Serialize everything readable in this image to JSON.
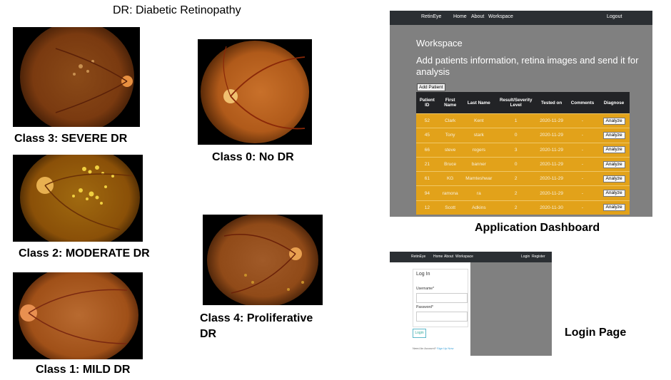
{
  "figure_title": "DR: Diabetic Retinopathy",
  "captions": {
    "class3": "Class 3: SEVERE DR",
    "class2": "Class 2: MODERATE DR",
    "class1": "Class 1: MILD DR",
    "class0": "Class 0: No DR",
    "class4_line1": "Class 4: Proliferative",
    "class4_line2": "DR",
    "dashboard": "Application Dashboard",
    "login": "Login Page"
  },
  "dashboard": {
    "brand": "RetinEye",
    "nav": [
      "Home",
      "About",
      "Workspace"
    ],
    "logout": "Logout",
    "title": "Workspace",
    "subtitle": "Add patients information, retina images and send it for analysis",
    "add_button": "Add Patient",
    "headers": [
      [
        "Patient",
        "ID"
      ],
      [
        "First",
        "Name"
      ],
      [
        "Last Name",
        ""
      ],
      [
        "Result/Severity",
        "Level"
      ],
      [
        "Tested on",
        ""
      ],
      [
        "Comments",
        ""
      ],
      [
        "Diagnose",
        ""
      ]
    ],
    "rows": [
      {
        "id": "52",
        "first": "Clark",
        "last": "Kent",
        "level": "1",
        "date": "2020-11-29",
        "comments": "-",
        "action": "Analyze"
      },
      {
        "id": "45",
        "first": "Tony",
        "last": "stark",
        "level": "0",
        "date": "2020-11-29",
        "comments": "-",
        "action": "Analyze"
      },
      {
        "id": "66",
        "first": "steve",
        "last": "rogers",
        "level": "3",
        "date": "2020-11-29",
        "comments": "-",
        "action": "Analyze"
      },
      {
        "id": "21",
        "first": "Bruce",
        "last": "banner",
        "level": "0",
        "date": "2020-11-29",
        "comments": "-",
        "action": "Analyze"
      },
      {
        "id": "61",
        "first": "KG",
        "last": "Mamteshwar",
        "level": "2",
        "date": "2020-11-29",
        "comments": "-",
        "action": "Analyze"
      },
      {
        "id": "94",
        "first": "ramona",
        "last": "ra",
        "level": "2",
        "date": "2020-11-29",
        "comments": "-",
        "action": "Analyze"
      },
      {
        "id": "12",
        "first": "Scott",
        "last": "Adkins",
        "level": "2",
        "date": "2020-11-30",
        "comments": "-",
        "action": "Analyze"
      }
    ]
  },
  "login": {
    "brand": "RetinEye",
    "nav": [
      "Home",
      "About",
      "Workspace"
    ],
    "right_nav": [
      "Login",
      "Register"
    ],
    "title": "Log In",
    "username_label": "Username*",
    "password_label": "Password*",
    "button": "Login",
    "need_text": "Need An Account?",
    "signup": "Sign Up Now"
  },
  "colors": {
    "table_row": "#e2a21a",
    "table_header": "#222326",
    "navbar": "#2b2f33",
    "app_background": "#808080"
  }
}
